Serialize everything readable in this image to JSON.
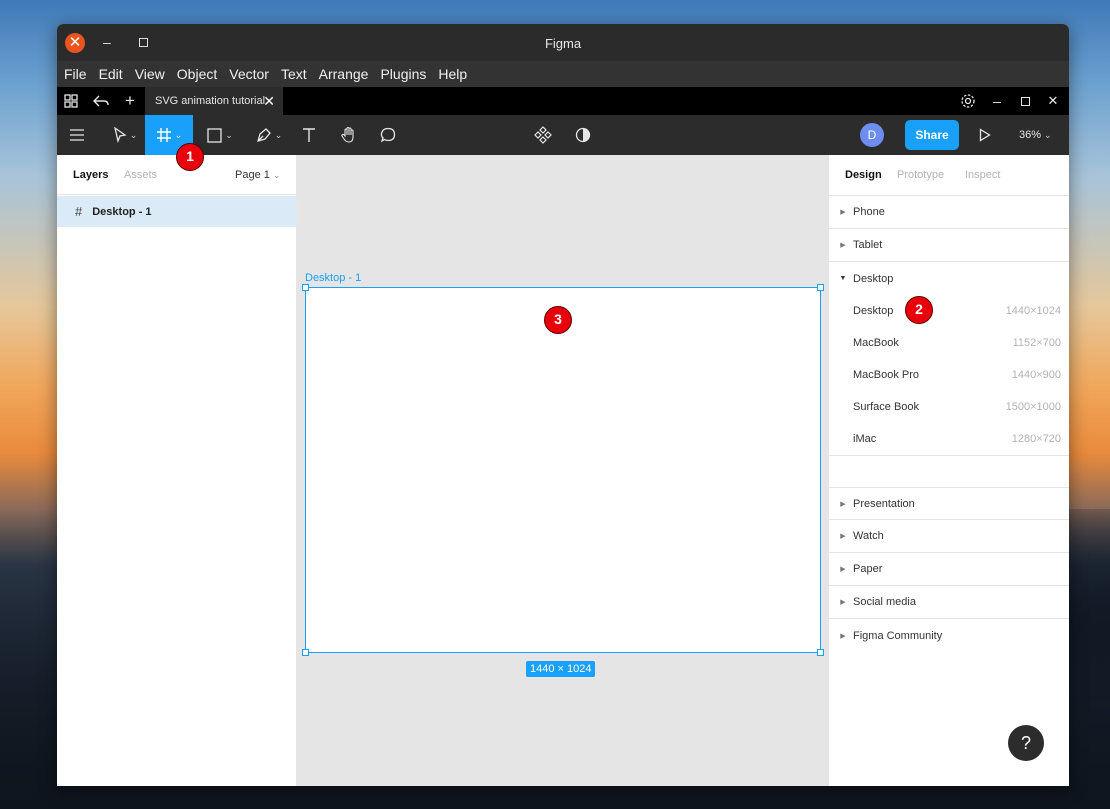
{
  "window": {
    "title": "Figma"
  },
  "menu": [
    "File",
    "Edit",
    "View",
    "Object",
    "Vector",
    "Text",
    "Arrange",
    "Plugins",
    "Help"
  ],
  "tab": {
    "file_name": "SVG animation tutorial"
  },
  "toolbar": {
    "avatar_initial": "D",
    "share_label": "Share",
    "zoom_label": "36%"
  },
  "left_panel": {
    "tab_layers": "Layers",
    "tab_assets": "Assets",
    "page_label": "Page 1",
    "layers": [
      {
        "name": "Desktop - 1"
      }
    ]
  },
  "canvas": {
    "frame_label": "Desktop - 1",
    "frame_size": "1440 × 1024"
  },
  "right_panel": {
    "tab_design": "Design",
    "tab_prototype": "Prototype",
    "tab_inspect": "Inspect",
    "sections_top": [
      "Phone",
      "Tablet"
    ],
    "expanded_section": "Desktop",
    "presets": [
      {
        "name": "Desktop",
        "size": "1440×1024"
      },
      {
        "name": "MacBook",
        "size": "1152×700"
      },
      {
        "name": "MacBook Pro",
        "size": "1440×900"
      },
      {
        "name": "Surface Book",
        "size": "1500×1000"
      },
      {
        "name": "iMac",
        "size": "1280×720"
      }
    ],
    "sections_bottom": [
      "Presentation",
      "Watch",
      "Paper",
      "Social media",
      "Figma Community"
    ]
  },
  "markers": [
    "1",
    "2",
    "3"
  ],
  "help_label": "?",
  "colors": {
    "accent": "#18a0fb",
    "marker": "#e8000b",
    "toolbar": "#2c2c2c"
  }
}
